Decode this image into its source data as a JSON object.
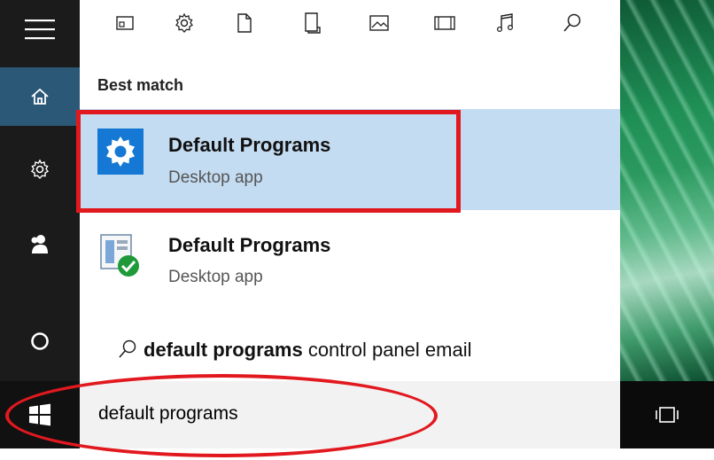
{
  "filters": {
    "items": [
      {
        "name": "apps-filter",
        "icon": "app-window-icon"
      },
      {
        "name": "settings-filter",
        "icon": "gear-icon"
      },
      {
        "name": "documents-filter",
        "icon": "document-icon"
      },
      {
        "name": "folders-filter",
        "icon": "folder-icon"
      },
      {
        "name": "photos-filter",
        "icon": "photo-icon"
      },
      {
        "name": "videos-filter",
        "icon": "video-icon"
      },
      {
        "name": "music-filter",
        "icon": "music-icon"
      },
      {
        "name": "web-filter",
        "icon": "search-icon"
      }
    ]
  },
  "section": {
    "best_match": "Best match"
  },
  "results": [
    {
      "title": "Default Programs",
      "subtitle": "Desktop app",
      "icon": "gear-app-icon",
      "selected": true
    },
    {
      "title": "Default Programs",
      "subtitle": "Desktop app",
      "icon": "default-programs-check-icon",
      "selected": false
    }
  ],
  "suggestion": {
    "bold": "default programs",
    "rest": " control panel email"
  },
  "search": {
    "query": "default programs"
  },
  "rail": [
    "hamburger-icon",
    "home-icon",
    "gear-icon",
    "people-icon",
    "cortana-icon"
  ],
  "colors": {
    "selection": "#c4dcf2",
    "rail": "#1b1b1b",
    "highlight_active": "#2b5876",
    "annotation_red": "#e1191f"
  }
}
